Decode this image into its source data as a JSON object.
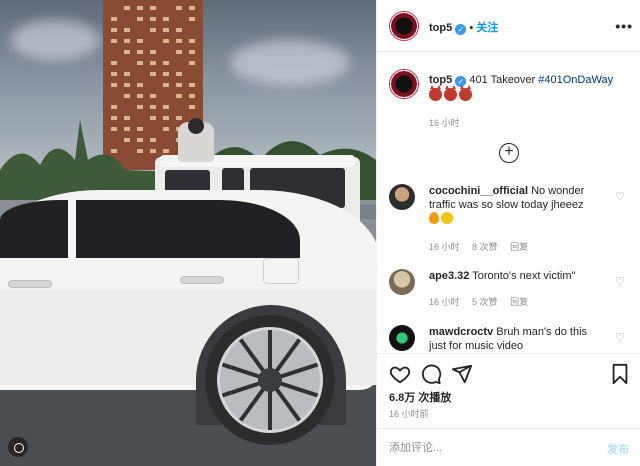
{
  "post": {
    "author": "top5",
    "follow_label": "关注",
    "more_label": "•••"
  },
  "caption": {
    "username": "top5",
    "text": "401 Takeover",
    "hashtag": "#401OnDaWay",
    "time": "16 小时"
  },
  "comments": [
    {
      "username": "cocochini__official",
      "text": "No wonder traffic was so slow today jheeez",
      "time": "16 小时",
      "likes": "8 次赞",
      "reply": "回复"
    },
    {
      "username": "ape3.32",
      "text": "Toronto's next victim\"",
      "time": "16 小时",
      "likes": "5 次赞",
      "reply": "回复"
    },
    {
      "username": "mawdcroctv",
      "text": "Bruh man's do this just for music video",
      "time": "",
      "likes": "",
      "reply": ""
    }
  ],
  "actions": {
    "like_icon": "heart-icon",
    "comment_icon": "comment-icon",
    "share_icon": "paper-plane-icon",
    "save_icon": "bookmark-icon",
    "views": "6.8万 次播放",
    "time": "16 小时前"
  },
  "comment_box": {
    "placeholder": "添加评论...",
    "post_label": "发布"
  },
  "colors": {
    "accent": "#0095f6",
    "verified": "#3897f0",
    "hashtag": "#00376b",
    "muted": "#8e8e8e"
  }
}
